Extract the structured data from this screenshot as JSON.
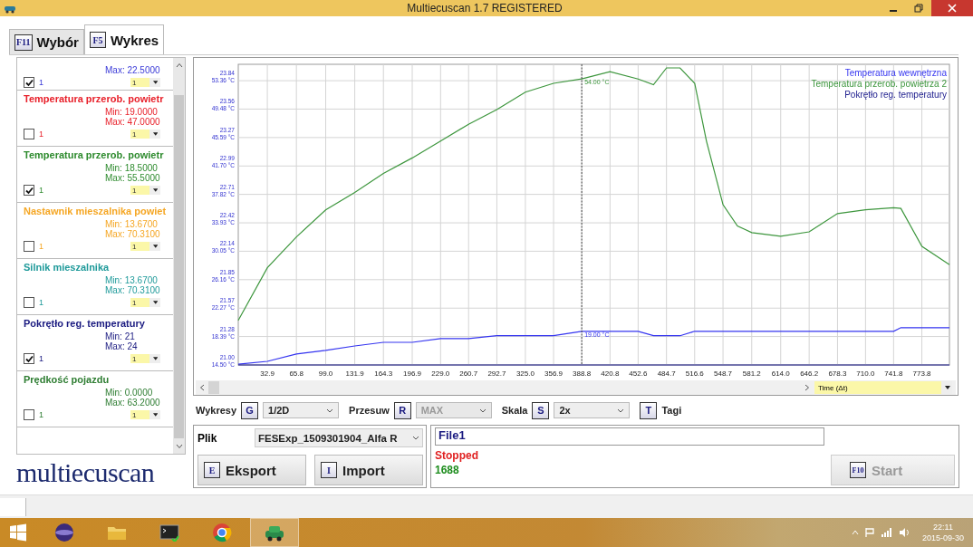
{
  "window": {
    "title": "Multiecuscan 1.7 REGISTERED"
  },
  "tabs": [
    {
      "key": "F11",
      "label": "Wybór",
      "selected": false
    },
    {
      "key": "F5",
      "label": "Wykres",
      "selected": true
    }
  ],
  "signals": [
    {
      "max": "Max: 22.5000",
      "checked": true,
      "count": "1",
      "scale": "1",
      "color": "#3a3ad8"
    },
    {
      "name": "Temperatura przerob. powietr",
      "min": "Min: 19.0000",
      "max": "Max: 47.0000",
      "checked": false,
      "count": "1",
      "scale": "1",
      "color": "#e8202a"
    },
    {
      "name": "Temperatura przerob. powietr",
      "min": "Min: 18.5000",
      "max": "Max: 55.5000",
      "checked": true,
      "count": "1",
      "scale": "1",
      "color": "#2e8b2e"
    },
    {
      "name": "Nastawnik mieszalnika powiet",
      "min": "Min: 13.6700",
      "max": "Max: 70.3100",
      "checked": false,
      "count": "1",
      "scale": "1",
      "color": "#f5a623"
    },
    {
      "name": "Silnik mieszalnika",
      "min": "Min: 13.6700",
      "max": "Max: 70.3100",
      "checked": false,
      "count": "1",
      "scale": "1",
      "color": "#1f9a9a"
    },
    {
      "name": "Pokrętło reg. temperatury",
      "min": "Min: 21",
      "max": "Max: 24",
      "checked": true,
      "count": "1",
      "scale": "1",
      "color": "#1a1a80"
    },
    {
      "name": "Prędkość pojazdu",
      "min": "Min: 0.0000",
      "max": "Max: 63.2000",
      "checked": false,
      "count": "1",
      "scale": "1",
      "color": "#2e7d32"
    }
  ],
  "logo": "multiecuscan",
  "chart": {
    "x_selector": "Time (Δt)",
    "chart_data": {
      "type": "line",
      "x": [
        0,
        32.9,
        65.8,
        99,
        131.9,
        164.3,
        196.9,
        229,
        260.7,
        292.7,
        325,
        356.9,
        388.8,
        420.8,
        452.6,
        470,
        484.7,
        500,
        516.6,
        530,
        548.7,
        565,
        581.2,
        614,
        646.2,
        678.3,
        710,
        741.8,
        750,
        773.8,
        805
      ],
      "series": [
        {
          "name": "Temperatura wewnętrzna",
          "color": "#3535f0",
          "values": [
            14.6,
            15.0,
            16.0,
            16.5,
            17.1,
            17.6,
            17.6,
            18.1,
            18.1,
            18.5,
            18.5,
            18.5,
            19.1,
            19.1,
            19.1,
            18.5,
            18.5,
            18.5,
            19.1,
            19.1,
            19.1,
            19.1,
            19.1,
            19.1,
            19.1,
            19.1,
            19.1,
            19.1,
            19.6,
            19.6,
            19.6
          ]
        },
        {
          "name": "Temperatura przerob. powietrza 2",
          "color": "#3d963d",
          "values": [
            20.6,
            27.8,
            32.0,
            35.7,
            38.1,
            40.7,
            42.8,
            45.1,
            47.4,
            49.4,
            51.8,
            53.0,
            53.6,
            54.6,
            53.6,
            52.8,
            55.1,
            55.1,
            53.0,
            45.1,
            36.4,
            33.5,
            32.6,
            32.1,
            32.7,
            35.2,
            35.7,
            36.0,
            35.9,
            30.7,
            28.2
          ]
        },
        {
          "name": "Pokrętło reg. temperatury",
          "color": "#1a1a8c",
          "values": [
            14.5,
            14.5,
            14.5,
            14.5,
            14.5,
            14.5,
            14.5,
            14.5,
            14.5,
            14.5,
            14.5,
            14.5,
            14.5,
            14.5,
            14.5,
            14.5,
            14.5,
            14.5,
            14.5,
            14.5,
            14.5,
            14.5,
            14.5,
            14.5,
            14.5,
            14.5,
            14.5,
            14.5,
            14.5,
            14.5,
            14.5
          ]
        }
      ],
      "xlim": [
        0,
        805
      ],
      "ylim": [
        14.5,
        55.6
      ],
      "xticks": [
        {
          "value": 32.9,
          "label": "32.9"
        },
        {
          "value": 65.8,
          "label": "65.8"
        },
        {
          "value": 99,
          "label": "99.0"
        },
        {
          "value": 131.9,
          "label": "131.9"
        },
        {
          "value": 164.3,
          "label": "164.3"
        },
        {
          "value": 196.9,
          "label": "196.9"
        },
        {
          "value": 229,
          "label": "229.0"
        },
        {
          "value": 260.7,
          "label": "260.7"
        },
        {
          "value": 292.7,
          "label": "292.7"
        },
        {
          "value": 325,
          "label": "325.0"
        },
        {
          "value": 356.9,
          "label": "356.9"
        },
        {
          "value": 388.8,
          "label": "388.8"
        },
        {
          "value": 420.8,
          "label": "420.8"
        },
        {
          "value": 452.6,
          "label": "452.6"
        },
        {
          "value": 484.7,
          "label": "484.7"
        },
        {
          "value": 516.6,
          "label": "516.6"
        },
        {
          "value": 548.7,
          "label": "548.7"
        },
        {
          "value": 581.2,
          "label": "581.2"
        },
        {
          "value": 614,
          "label": "614.0"
        },
        {
          "value": 646.2,
          "label": "646.2"
        },
        {
          "value": 678.3,
          "label": "678.3"
        },
        {
          "value": 710,
          "label": "710.0"
        },
        {
          "value": 741.8,
          "label": "741.8"
        },
        {
          "value": 773.8,
          "label": "773.8"
        }
      ],
      "yticks": [
        {
          "value": 14.5,
          "label": "14.50 °C"
        },
        {
          "value": 18.39,
          "label": "18.39 °C"
        },
        {
          "value": 22.27,
          "label": "22.27 °C"
        },
        {
          "value": 26.16,
          "label": "26.16 °C"
        },
        {
          "value": 30.05,
          "label": "30.05 °C"
        },
        {
          "value": 33.93,
          "label": "33.93 °C"
        },
        {
          "value": 37.82,
          "label": "37.82 °C"
        },
        {
          "value": 41.7,
          "label": "41.70 °C"
        },
        {
          "value": 45.59,
          "label": "45.59 °C"
        },
        {
          "value": 49.48,
          "label": "49.48 °C"
        },
        {
          "value": 53.36,
          "label": "53.36 °C"
        }
      ],
      "grid": true,
      "ref_lines": [
        {
          "axis": "x",
          "value": 388.8
        }
      ],
      "annotations": [
        {
          "x": 388.8,
          "y": 53.6,
          "text": "54.00 °C"
        },
        {
          "x": 388.8,
          "y": 19.1,
          "text": "19.00 °C"
        }
      ]
    },
    "secondary_scale": [
      "23.84",
      "23.56",
      "23.27",
      "22.99",
      "22.71",
      "22.42",
      "22.14",
      "21.85",
      "21.57",
      "21.28",
      "21.00"
    ]
  },
  "controls": [
    {
      "kind": "select",
      "label": "Wykresy",
      "key": "G",
      "value": "1/2D",
      "disabled": false
    },
    {
      "kind": "select",
      "label": "Przesuw",
      "key": "R",
      "value": "MAX",
      "disabled": true
    },
    {
      "kind": "select",
      "label": "Skala",
      "key": "S",
      "value": "2x",
      "disabled": false
    },
    {
      "kind": "toggle",
      "label": "Tagi",
      "key": "T"
    }
  ],
  "file": {
    "label": "Plik",
    "value": "FESExp_1509301904_Alfa R"
  },
  "actions": [
    {
      "key": "E",
      "label": "Eksport"
    },
    {
      "key": "I",
      "label": "Import"
    }
  ],
  "name_field": {
    "value": "File1"
  },
  "status": {
    "state": "Stopped",
    "count": "1688"
  },
  "start_button": {
    "key": "F10",
    "label": "Start",
    "disabled": true
  },
  "taskbar": {
    "time": "22:11",
    "date": "2015-09-30"
  }
}
